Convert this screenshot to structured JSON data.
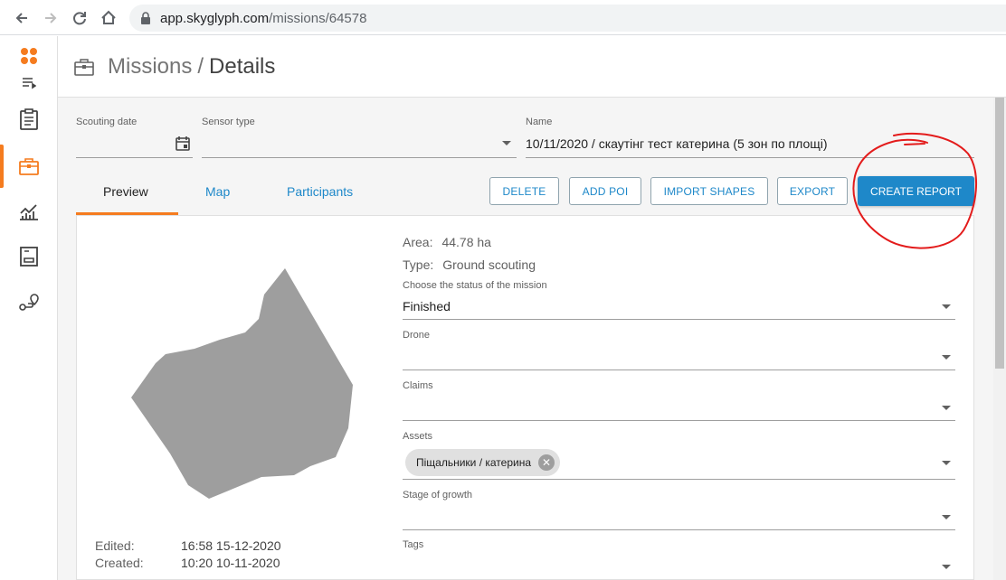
{
  "browser": {
    "url_host": "app.skyglyph.com",
    "url_path": "/missions/64578"
  },
  "header": {
    "section": "Missions",
    "separator": "/",
    "page": "Details"
  },
  "form": {
    "scouting_date_label": "Scouting date",
    "sensor_type_label": "Sensor type",
    "name_label": "Name",
    "name_value": "10/11/2020 / скаутінг тест катерина (5 зон по площі)"
  },
  "tabs": [
    {
      "label": "Preview"
    },
    {
      "label": "Map"
    },
    {
      "label": "Participants"
    }
  ],
  "actions": {
    "delete": "DELETE",
    "add_poi": "ADD POI",
    "import_shapes": "IMPORT SHAPES",
    "export": "EXPORT",
    "create_report": "CREATE REPORT"
  },
  "details": {
    "area_label": "Area:",
    "area_value": "44.78 ha",
    "type_label": "Type:",
    "type_value": "Ground scouting",
    "status_label": "Choose the status of the mission",
    "status_value": "Finished",
    "drone_label": "Drone",
    "claims_label": "Claims",
    "assets_label": "Assets",
    "asset_chip": "Піщальники / катерина",
    "stage_label": "Stage of growth",
    "tags_label": "Tags"
  },
  "meta": {
    "edited_label": "Edited:",
    "edited_value": "16:58 15-12-2020",
    "created_label": "Created:",
    "created_value": "10:20 10-11-2020"
  },
  "colors": {
    "accent": "#f57c1f",
    "primary": "#1e88c9",
    "annotation": "#e31b1b"
  }
}
